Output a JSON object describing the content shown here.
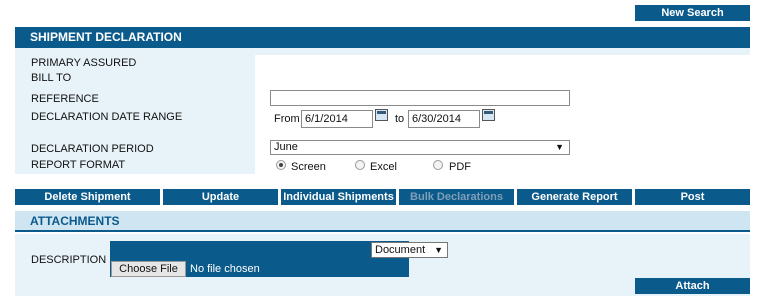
{
  "toolbar": {
    "new_search": "New Search"
  },
  "shipment": {
    "header": "SHIPMENT DECLARATION",
    "labels": {
      "primary_assured": "PRIMARY ASSURED",
      "bill_to": "BILL TO",
      "reference": "REFERENCE",
      "date_range": "DECLARATION DATE RANGE",
      "period": "DECLARATION PERIOD",
      "format": "REPORT FORMAT"
    },
    "reference_value": "",
    "from_label": "From",
    "from_value": "6/1/2014",
    "to_label": "to",
    "to_value": "6/30/2014",
    "period_selected": "June",
    "formats": [
      "Screen",
      "Excel",
      "PDF"
    ],
    "format_selected": "Screen"
  },
  "actions": {
    "delete": "Delete Shipment Declaration",
    "update": "Update",
    "individual": "Individual Shipments",
    "bulk": "Bulk Declarations",
    "generate": "Generate Report",
    "post": "Post"
  },
  "attachments": {
    "header": "ATTACHMENTS",
    "description_label": "DESCRIPTION",
    "doc_type_selected": "Document",
    "choose_file": "Choose File",
    "no_file": "No file chosen",
    "attach": "Attach"
  },
  "colors": {
    "primary": "#0b5a8c",
    "panel": "#e8f3f9",
    "light_header": "#cfe6f2"
  },
  "icons": [
    "calendar-icon",
    "dropdown-arrow-icon",
    "radio-button-icon"
  ]
}
